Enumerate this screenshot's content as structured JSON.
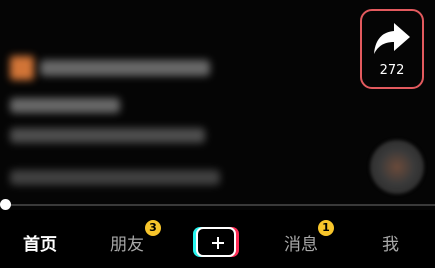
{
  "share": {
    "icon": "share-arrow-icon",
    "count": "272",
    "highlight_color": "#e35a5e"
  },
  "playback": {
    "progress": 0.0
  },
  "nav": {
    "home": "首页",
    "friends": "朋友",
    "friends_badge": "3",
    "create_icon": "plus-icon",
    "messages": "消息",
    "messages_badge": "1",
    "me": "我"
  },
  "colors": {
    "badge": "#f7c52b",
    "cyan": "#25f4ee",
    "red": "#fe2c55"
  }
}
